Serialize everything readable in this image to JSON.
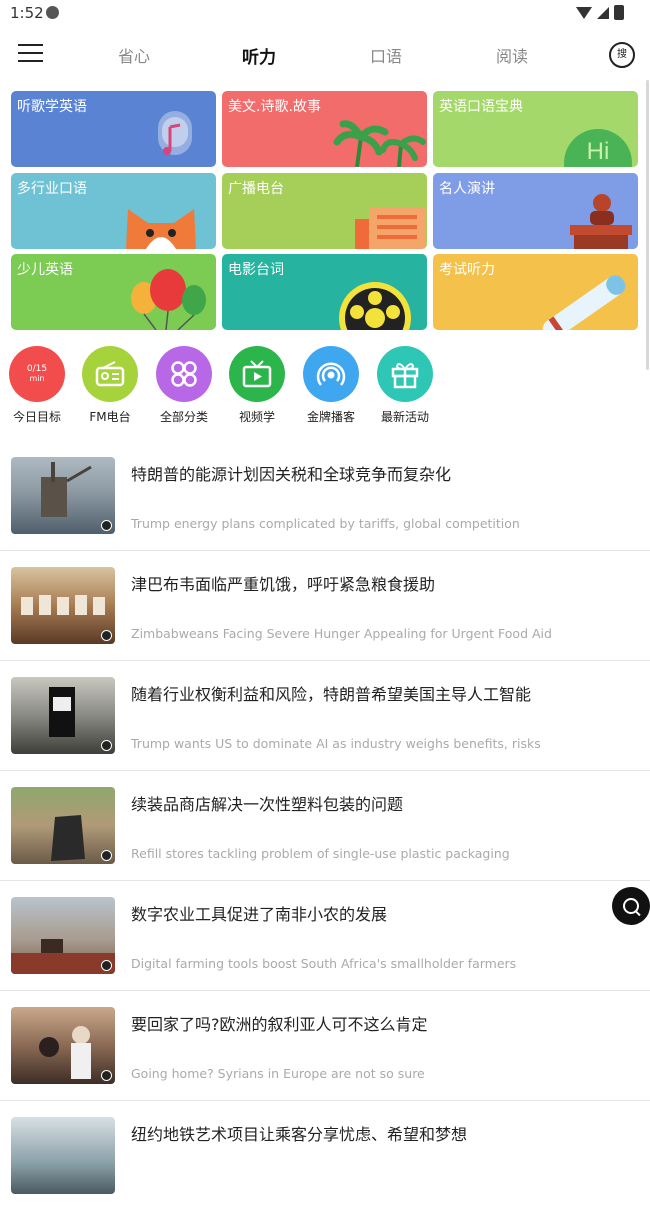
{
  "status_bar": {
    "time": "1:52"
  },
  "nav": {
    "tabs": [
      {
        "label": "省心"
      },
      {
        "label": "听力"
      },
      {
        "label": "口语"
      },
      {
        "label": "阅读"
      }
    ],
    "search_label": "搜"
  },
  "categories": [
    {
      "label": "听歌学英语",
      "color": "#5b83d3"
    },
    {
      "label": "美文.诗歌.故事",
      "color": "#f26c6c"
    },
    {
      "label": "英语口语宝典",
      "color": "#a4d86b"
    },
    {
      "label": "多行业口语",
      "color": "#6ec2d4"
    },
    {
      "label": "广播电台",
      "color": "#a6cf5a"
    },
    {
      "label": "名人演讲",
      "color": "#7f9de6"
    },
    {
      "label": "少儿英语",
      "color": "#7ccc53"
    },
    {
      "label": "电影台词",
      "color": "#26b3a0"
    },
    {
      "label": "考试听力",
      "color": "#f4c24a"
    }
  ],
  "category_icon_text": {
    "hi": "Hi"
  },
  "shortcuts": [
    {
      "label": "今日目标",
      "color": "#f24c4c",
      "goal_value": "0/15",
      "goal_unit": "min"
    },
    {
      "label": "FM电台",
      "color": "#a6d23c",
      "icon": "radio-icon"
    },
    {
      "label": "全部分类",
      "color": "#b868e6",
      "icon": "grid-icon"
    },
    {
      "label": "视频学",
      "color": "#2bb54b",
      "icon": "tv-icon"
    },
    {
      "label": "金牌播客",
      "color": "#3fa6f0",
      "icon": "podcast-icon"
    },
    {
      "label": "最新活动",
      "color": "#2ec6b4",
      "icon": "gift-icon"
    }
  ],
  "news": [
    {
      "title": "特朗普的能源计划因关税和全球竞争而复杂化",
      "subtitle": "Trump energy plans complicated by tariffs, global competition",
      "thumb_color": "#6b7a86"
    },
    {
      "title": "津巴布韦面临严重饥饿，呼吁紧急粮食援助",
      "subtitle": "Zimbabweans Facing Severe Hunger Appealing for Urgent Food Aid",
      "thumb_color": "#9d7b56"
    },
    {
      "title": "随着行业权衡利益和风险，特朗普希望美国主导人工智能",
      "subtitle": "Trump wants US to dominate AI as industry weighs benefits, risks",
      "thumb_color": "#5e5e5e"
    },
    {
      "title": "续装品商店解决一次性塑料包装的问题",
      "subtitle": "Refill stores tackling problem of single-use plastic packaging",
      "thumb_color": "#7d8a64"
    },
    {
      "title": "数字农业工具促进了南非小农的发展",
      "subtitle": "Digital farming tools boost South Africa's smallholder farmers",
      "thumb_color": "#9a8070"
    },
    {
      "title": "要回家了吗?欧洲的叙利亚人可不这么肯定",
      "subtitle": "Going home? Syrians in Europe are not so sure",
      "thumb_color": "#8b6a55"
    },
    {
      "title": "纽约地铁艺术项目让乘客分享忧虑、希望和梦想",
      "subtitle": "",
      "thumb_color": "#8aa0a8"
    }
  ]
}
